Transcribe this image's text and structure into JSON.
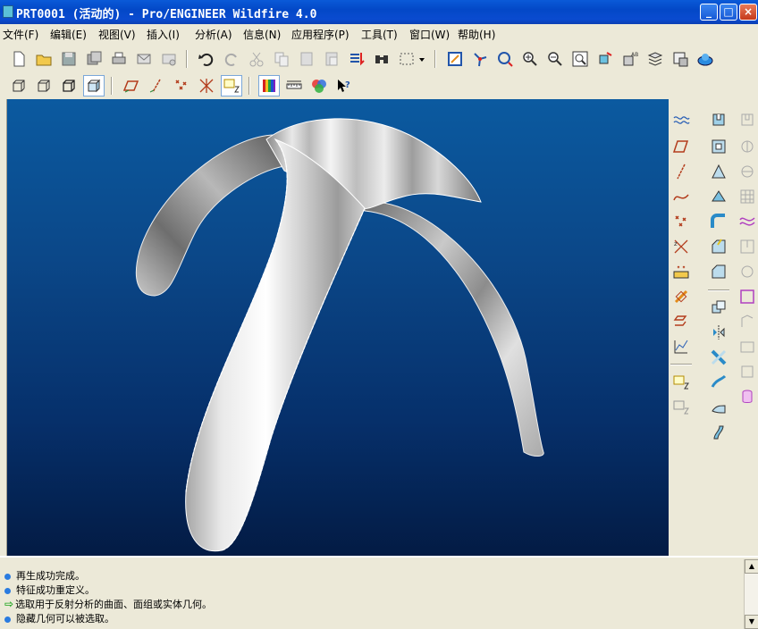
{
  "window": {
    "title": "PRT0001 (活动的) - Pro/ENGINEER Wildfire 4.0",
    "minimize": "_",
    "maximize": "□",
    "close": "×"
  },
  "menu": [
    "文件(F)",
    "编辑(E)",
    "视图(V)",
    "插入(I)",
    "分析(A)",
    "信息(N)",
    "应用程序(P)",
    "工具(T)",
    "窗口(W)",
    "帮助(H)"
  ],
  "toolbar1": [
    "new-icon",
    "open-icon",
    "save-icon",
    "save-copy-icon",
    "print-icon",
    "send-mail-icon",
    "send-link-icon",
    "undo-icon",
    "redo-icon",
    "cut-icon",
    "copy-icon",
    "paste-icon",
    "paste-special-icon",
    "regenerate-icon",
    "find-icon",
    "select-box-icon",
    "dropdown-icon",
    "repaint-icon",
    "spin-center-icon",
    "orient-icon",
    "zoom-in-icon",
    "zoom-out-icon",
    "refit-icon",
    "reorient-icon",
    "saved-views-icon",
    "layers-icon",
    "view-manager-icon",
    "appearance-icon"
  ],
  "toolbar2": [
    "wireframe-icon",
    "hidden-line-icon",
    "no-hidden-icon",
    "shading-icon",
    "datum-planes-icon",
    "datum-axes-icon",
    "datum-points-icon",
    "coordinate-systems-icon",
    "annotation-icon",
    "reflection-analysis-icon",
    "measure-icon",
    "color-icon",
    "whats-this-icon"
  ],
  "messages": [
    {
      "type": "info",
      "text": "再生成功完成。"
    },
    {
      "type": "info",
      "text": "特征成功重定义。"
    },
    {
      "type": "prompt",
      "text": "选取用于反射分析的曲面、面组或实体几何。"
    },
    {
      "type": "info",
      "text": "隐藏几何可以被选取。"
    }
  ],
  "colors": {
    "titlebar": "#0a4bd0",
    "background_top": "#0b5aa0",
    "background_bottom": "#031b44",
    "model_gray": "#c8c8c8"
  }
}
